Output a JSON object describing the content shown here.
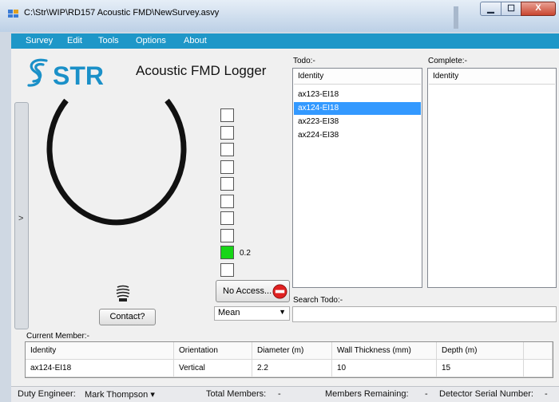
{
  "window": {
    "title": "C:\\Str\\WIP\\RD157 Acoustic FMD\\NewSurvey.asvy",
    "controls": {
      "minimize": "▁",
      "maximize": "☐",
      "close": "X"
    }
  },
  "menu": [
    "Survey",
    "Edit",
    "Tools",
    "Options",
    "About"
  ],
  "logo": {
    "text": "STR",
    "color": "#1a90c8"
  },
  "app_title": "Acoustic FMD Logger",
  "side_panel": {
    "arrow": ">"
  },
  "meter": {
    "value": "0.2",
    "boxes": 10,
    "active_index": 8,
    "active_color": "#17d617"
  },
  "buttons": {
    "contact": "Contact?",
    "no_access": "No Access..."
  },
  "mean_select": {
    "value": "Mean",
    "arrow": "▼"
  },
  "todo": {
    "label": "Todo:-",
    "header": "Identity",
    "items": [
      "ax123-EI18",
      "ax124-EI18",
      "ax223-EI38",
      "ax224-EI38"
    ],
    "selected_index": 1
  },
  "complete": {
    "label": "Complete:-",
    "header": "Identity",
    "items": []
  },
  "search": {
    "label": "Search Todo:-",
    "value": ""
  },
  "current_member": {
    "label": "Current Member:-",
    "columns": [
      "Identity",
      "Orientation",
      "Diameter (m)",
      "Wall Thickness (mm)",
      "Depth (m)"
    ],
    "row": [
      "ax124-EI18",
      "Vertical",
      "2.2",
      "10",
      "15"
    ]
  },
  "status": {
    "duty_engineer_label": "Duty Engineer:",
    "duty_engineer_value": "Mark Thompson",
    "dropdown_arrow": "▾",
    "total_members_label": "Total Members:",
    "total_members_value": "-",
    "members_remaining_label": "Members Remaining:",
    "members_remaining_value": "-",
    "detector_label": "Detector Serial Number:",
    "detector_value": "-"
  },
  "colors": {
    "menubar": "#1e97c8",
    "selection": "#3399ff",
    "brand": "#1a90c8"
  }
}
